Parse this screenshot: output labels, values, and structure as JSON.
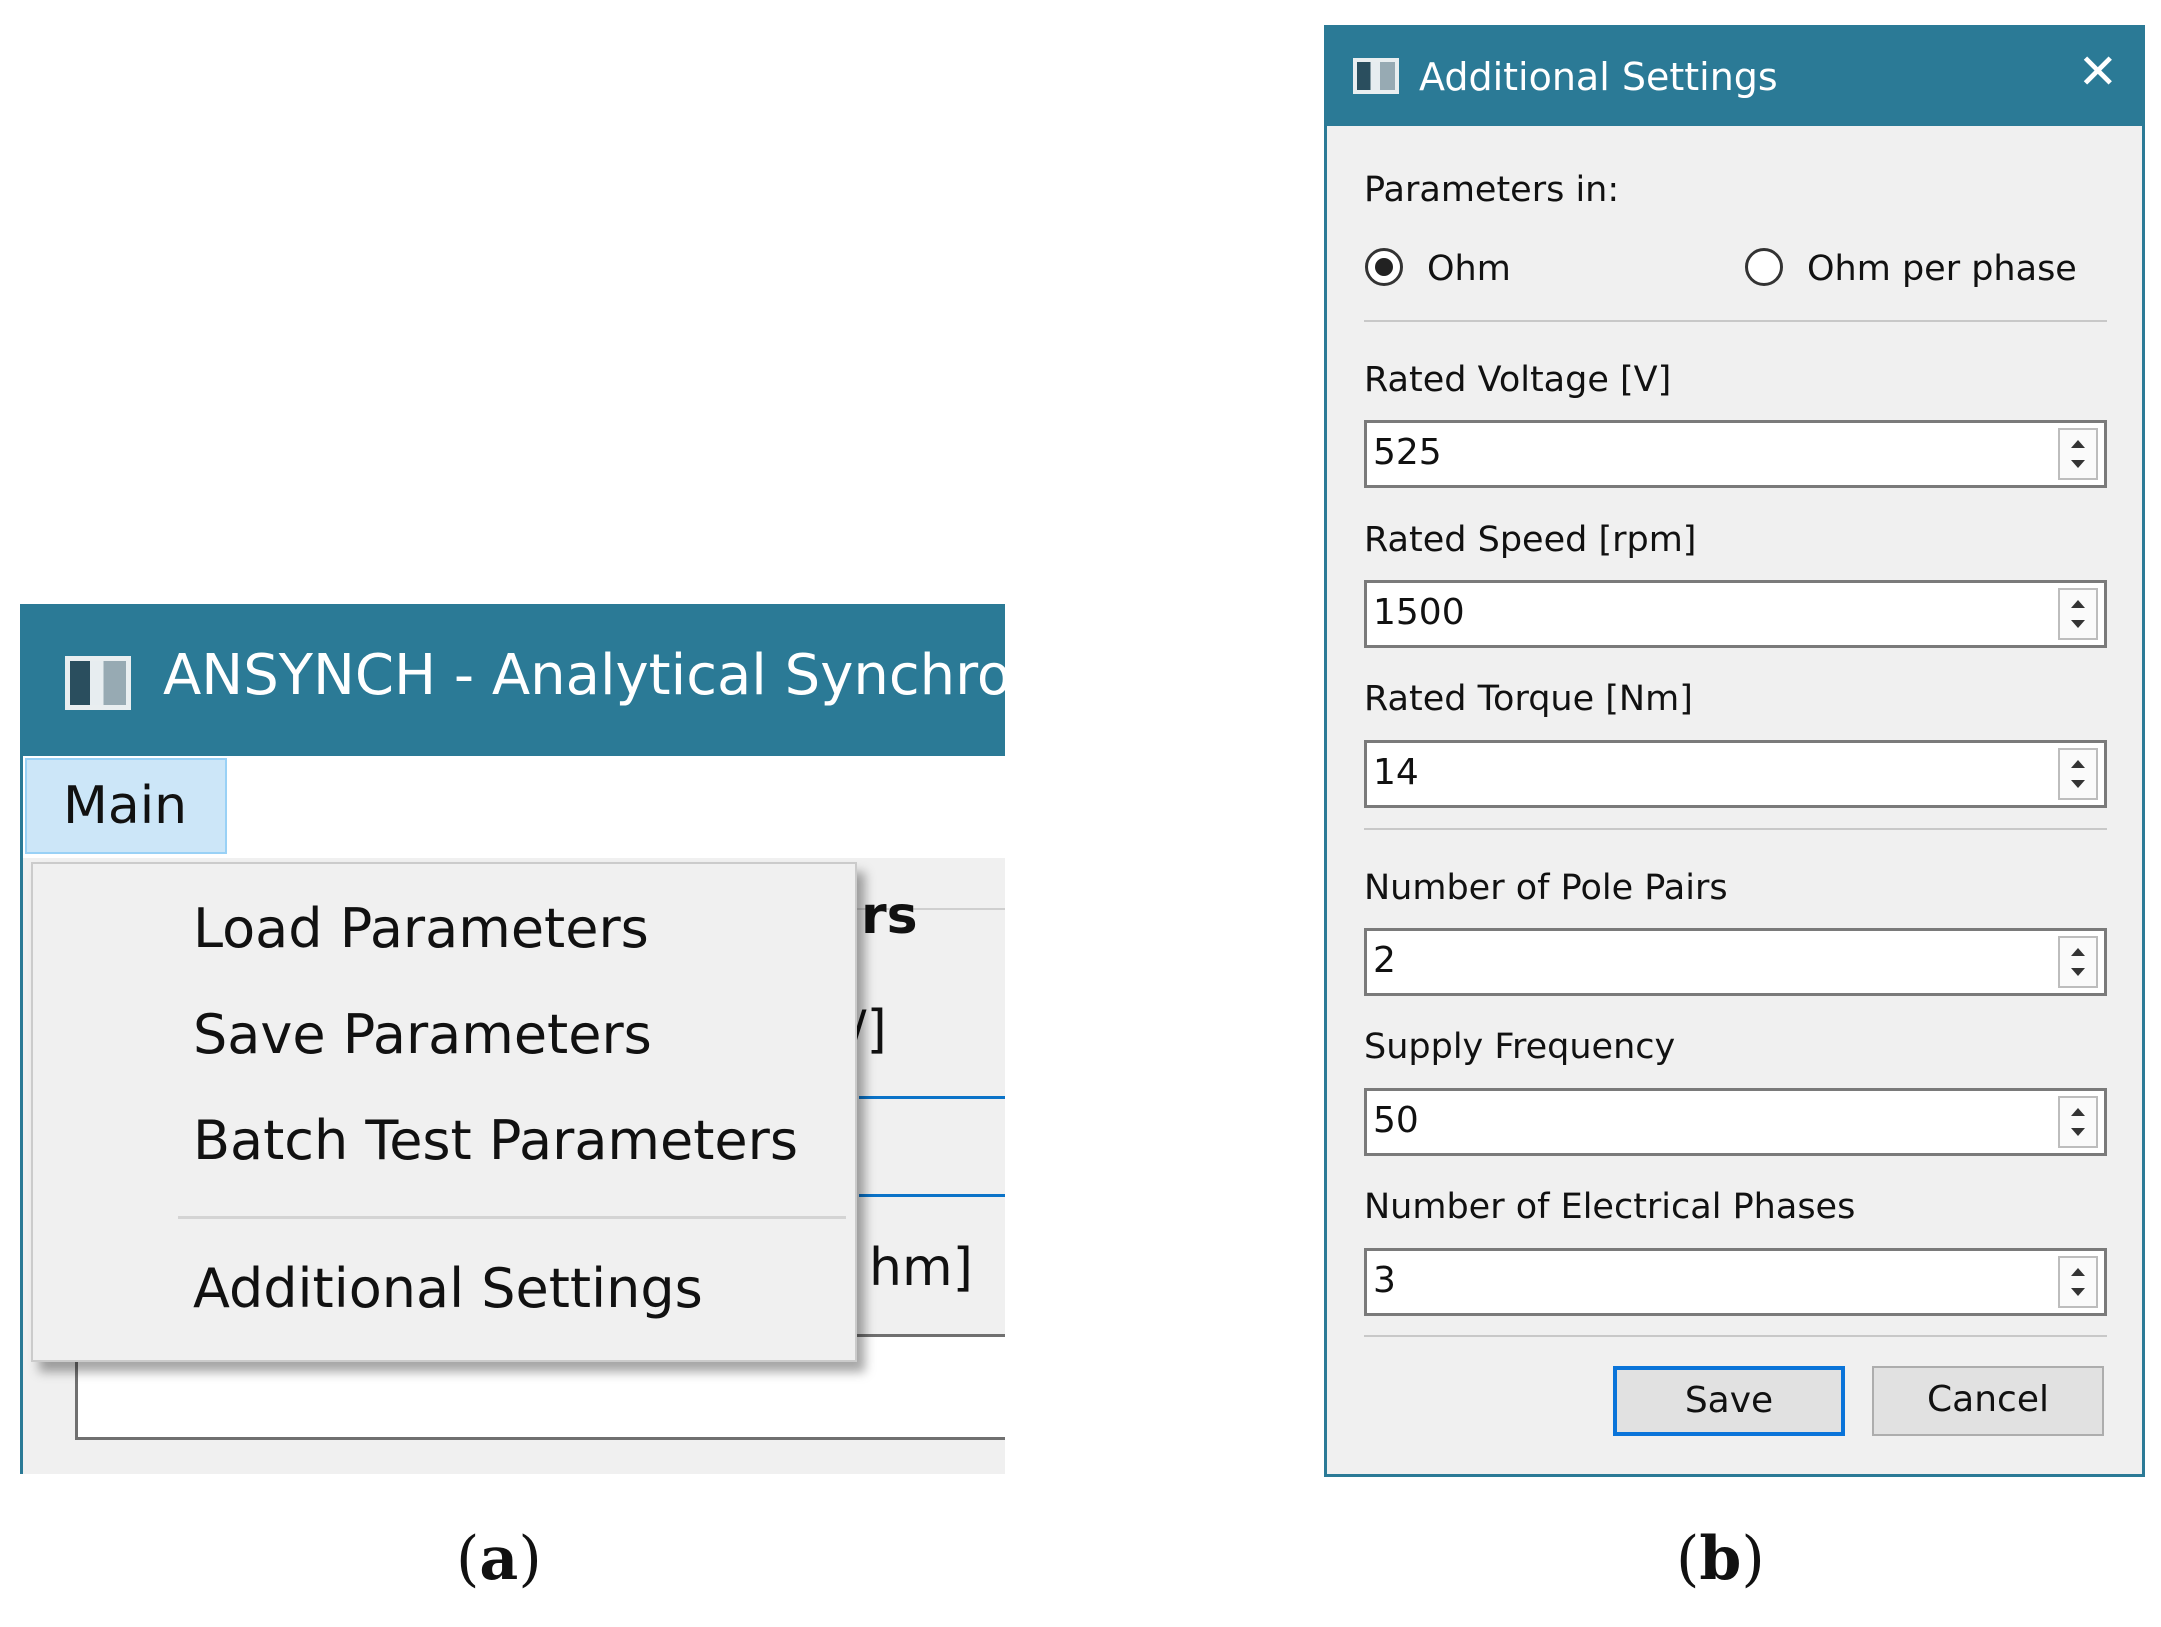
{
  "panel_a": {
    "window_title": "ANSYNCH - Analytical Synchroni",
    "menu_main": "Main",
    "dropdown_items": [
      "Load Parameters",
      "Save Parameters",
      "Batch Test Parameters",
      "Additional Settings"
    ],
    "background_fragments": [
      "rs",
      "/]",
      "hm]"
    ],
    "caption_open": "(",
    "caption_letter": "a",
    "caption_close": ")"
  },
  "panel_b": {
    "dialog_title": "Additional Settings",
    "close_symbol": "✕",
    "parameters_in_label": "Parameters in:",
    "radio_ohm": "Ohm",
    "radio_ohm_per_phase": "Ohm per phase",
    "selected_radio": "Ohm",
    "fields": [
      {
        "label": "Rated Voltage [V]",
        "value": "525"
      },
      {
        "label": "Rated Speed [rpm]",
        "value": "1500"
      },
      {
        "label": "Rated Torque [Nm]",
        "value": "14"
      },
      {
        "label": "Number of Pole Pairs",
        "value": "2"
      },
      {
        "label": "Supply Frequency",
        "value": "50"
      },
      {
        "label": "Number of Electrical Phases",
        "value": "3"
      }
    ],
    "save_label": "Save",
    "cancel_label": "Cancel",
    "caption_open": "(",
    "caption_letter": "b",
    "caption_close": ")"
  },
  "colors": {
    "titlebar": "#2b7a96",
    "menu_highlight": "#cce6f8",
    "accent_blue": "#0a74d9",
    "window_bg": "#f0f0f0"
  },
  "icons": [
    "app-window-icon",
    "close-icon",
    "spin-up-icon",
    "spin-down-icon"
  ]
}
